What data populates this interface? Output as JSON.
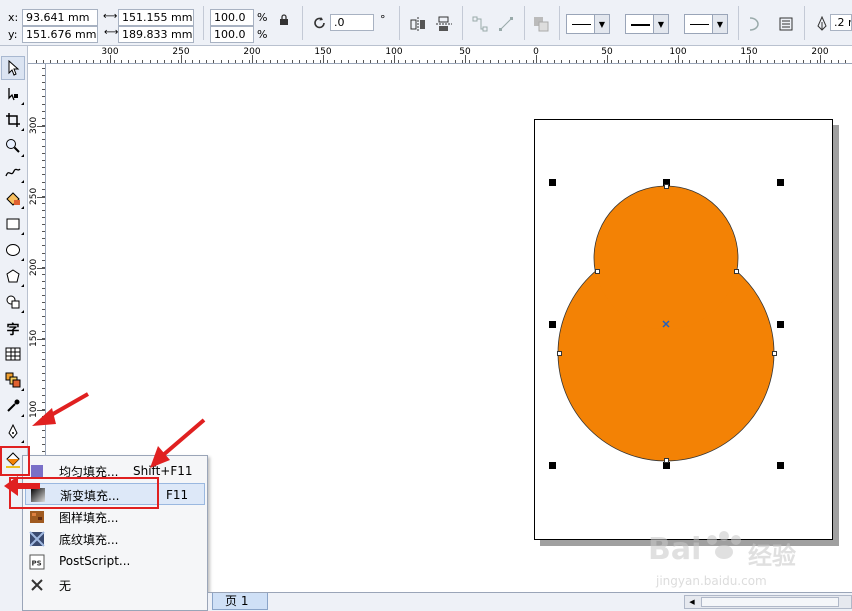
{
  "propbar": {
    "x_label": "x:",
    "y_label": "y:",
    "x_value": "93.641 mm",
    "y_value": "151.676 mm",
    "width_value": "151.155 mm",
    "height_value": "189.833 mm",
    "scale_x": "100.0",
    "scale_y": "100.0",
    "percent": "%",
    "rotation_value": ".0",
    "degree": "°",
    "outline_width": ".2 m"
  },
  "ruler": {
    "h_labels": [
      "300",
      "250",
      "200",
      "150",
      "100",
      "50",
      "0",
      "50",
      "100",
      "150",
      "200"
    ],
    "v_labels": [
      "300",
      "250",
      "200",
      "150",
      "100"
    ]
  },
  "flyout": {
    "items": [
      {
        "label": "均匀填充...",
        "shortcut": "Shift+F11"
      },
      {
        "label": "渐变填充...",
        "shortcut": "F11"
      },
      {
        "label": "图样填充...",
        "shortcut": ""
      },
      {
        "label": "底纹填充...",
        "shortcut": ""
      },
      {
        "label": "PostScript...",
        "shortcut": ""
      },
      {
        "label": "无",
        "shortcut": ""
      }
    ]
  },
  "toolbox": {
    "text_tool_glyph": "字"
  },
  "bottom": {
    "page_tab": "页 1"
  },
  "watermark": {
    "brand": "Bai",
    "brand2": "经验",
    "url": "jingyan.baidu.com"
  },
  "colors": {
    "shape_fill": "#f38205",
    "annotation_red": "#e02020"
  }
}
